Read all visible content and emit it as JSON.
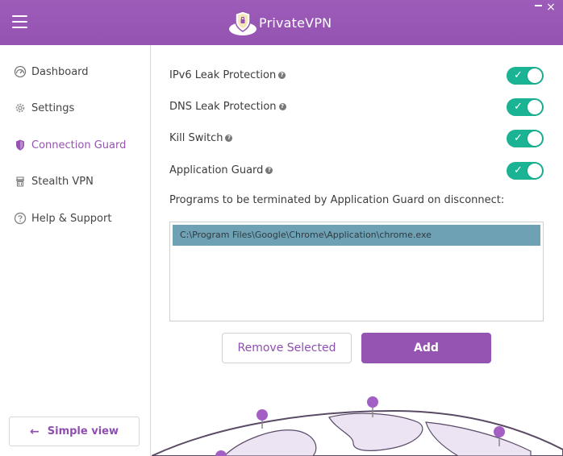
{
  "app": {
    "title": "PrivateVPN"
  },
  "window": {
    "close_glyph": "×"
  },
  "sidebar": {
    "items": [
      {
        "label": "Dashboard",
        "icon": "dashboard-icon"
      },
      {
        "label": "Settings",
        "icon": "gear-icon"
      },
      {
        "label": "Connection Guard",
        "icon": "shield-icon",
        "active": true
      },
      {
        "label": "Stealth VPN",
        "icon": "stealth-icon"
      },
      {
        "label": "Help & Support",
        "icon": "help-icon"
      }
    ],
    "simple_view_label": "Simple view"
  },
  "toggles": [
    {
      "label": "IPv6 Leak Protection",
      "on": true
    },
    {
      "label": "DNS Leak Protection",
      "on": true
    },
    {
      "label": "Kill Switch",
      "on": true
    },
    {
      "label": "Application Guard",
      "on": true
    }
  ],
  "programs": {
    "label": "Programs to be terminated by Application Guard on disconnect:",
    "items": [
      "C:\\Program Files\\Google\\Chrome\\Application\\chrome.exe"
    ],
    "selected_index": 0
  },
  "buttons": {
    "remove_label": "Remove Selected",
    "add_label": "Add"
  },
  "colors": {
    "brand": "#9553b2",
    "toggle_on": "#1ab394",
    "selection": "#6fa1b4"
  }
}
